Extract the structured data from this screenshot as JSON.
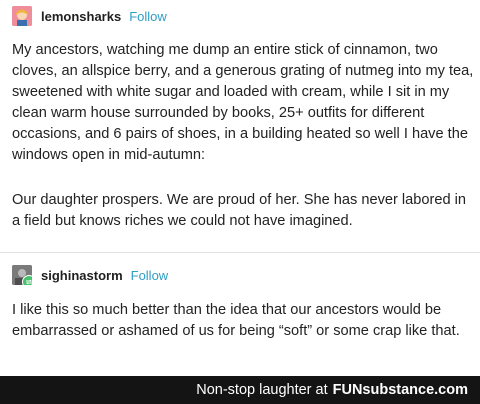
{
  "post1": {
    "username": "lemonsharks",
    "follow_label": "Follow",
    "paragraphs": [
      "My ancestors, watching me dump an entire stick of cinnamon, two cloves, an allspice berry, and a generous grating of nutmeg into my tea, sweetened with white sugar and loaded with cream, while I sit in my clean warm house surrounded by books, 25+ outfits for different occasions, and 6 pairs of shoes, in a building heated so well I have the windows open in mid-autumn:",
      "Our daughter prospers. We are proud of her. She has never labored in a field but knows riches we could not have imagined."
    ]
  },
  "post2": {
    "username": "sighinastorm",
    "follow_label": "Follow",
    "paragraphs": [
      "I like this so much better than the idea that our ancestors would be embarrassed or ashamed of us for being “soft” or some crap like that."
    ]
  },
  "footer": {
    "text": "Non-stop laughter at",
    "brand": "FUNsubstance",
    "brand_suffix": ".com"
  },
  "colors": {
    "follow": "#2f9ec7",
    "footer_bg": "#141414",
    "reblog_badge": "#47c26b"
  }
}
